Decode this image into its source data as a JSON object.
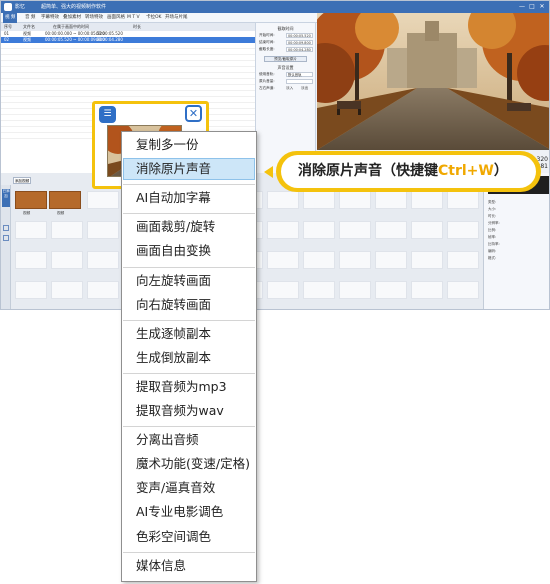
{
  "app": {
    "name": "影忆",
    "subtitle": "超简单、强大的视频制作软件",
    "window_buttons": [
      "—",
      "□",
      "✕"
    ],
    "tabs": [
      "视 频",
      "音 频",
      "字幕特效",
      "叠加素材",
      "转场特效",
      "画面风格",
      "M T V",
      "卡拉OK",
      "开场与片尾"
    ],
    "active_tab": 0
  },
  "file_list": {
    "columns": [
      "序号",
      "文件名",
      "在属于画面中的时间",
      "时长"
    ],
    "rows": [
      {
        "num": "01",
        "name": "视频",
        "range": "00:00:00.000 ~ 00:00:05.520",
        "dur": "00:00:05.520"
      },
      {
        "num": "02",
        "name": "视频",
        "range": "00:00:05.520 ~ 00:00:09.800",
        "dur": "00:00:04.280"
      }
    ],
    "selected_row": 1
  },
  "props": {
    "time_section": "截取时间",
    "start_label": "开始时间:",
    "start_value": "00:00:05.520",
    "end_label": "结束时间:",
    "end_value": "00:00:09.800",
    "dur_label": "截取长度:",
    "dur_value": "00:00:04.280",
    "preview_btn": "预览/截取原片",
    "audio_section": "声音设置",
    "track_label": "使用音轨:",
    "track_value": "默认音轨",
    "volume_label": "原片音量:",
    "volume_value": "",
    "fade_label": "左右声道:",
    "fade_in": "淡入",
    "fade_out": "淡出"
  },
  "timecode": [
    "320",
    "381"
  ],
  "timeline": {
    "tab": "添加视频",
    "side_btn": "已添加",
    "clip_labels": [
      "视频",
      "视频"
    ],
    "right_panel": [
      "类型:",
      "大小:",
      "时长:",
      "分辨率:",
      "比例:",
      "帧率:",
      "比特率:",
      "编码:",
      "格式:"
    ]
  },
  "thumb": {
    "list_icon": "list-icon",
    "close_icon": "close-icon",
    "list_glyph": "☰",
    "close_glyph": "✕"
  },
  "menu": {
    "items": [
      {
        "label": "复制多一份",
        "group": 0
      },
      {
        "label": "消除原片声音",
        "group": 0,
        "highlighted": true
      },
      {
        "label": "AI自动加字幕",
        "group": 1
      },
      {
        "label": "画面裁剪/旋转",
        "group": 2
      },
      {
        "label": "画面自由变换",
        "group": 2
      },
      {
        "label": "向左旋转画面",
        "group": 3
      },
      {
        "label": "向右旋转画面",
        "group": 3
      },
      {
        "label": "生成逐帧副本",
        "group": 4
      },
      {
        "label": "生成倒放副本",
        "group": 4
      },
      {
        "label": "提取音频为mp3",
        "group": 5
      },
      {
        "label": "提取音频为wav",
        "group": 5
      },
      {
        "label": "分离出音频",
        "group": 6
      },
      {
        "label": "魔术功能(变速/定格)",
        "group": 6
      },
      {
        "label": "变声/逼真音效",
        "group": 6
      },
      {
        "label": "AI专业电影调色",
        "group": 6
      },
      {
        "label": "色彩空间调色",
        "group": 6
      },
      {
        "label": "媒体信息",
        "group": 7
      }
    ]
  },
  "callout": {
    "text": "消除原片声音（快捷键",
    "hotkey": "Ctrl+W",
    "close": "）"
  },
  "colors": {
    "accent_yellow": "#f4c20d",
    "highlight_bg": "#cde6f8",
    "brand_blue": "#3c6fb5",
    "hotkey_color": "#f0a800"
  }
}
